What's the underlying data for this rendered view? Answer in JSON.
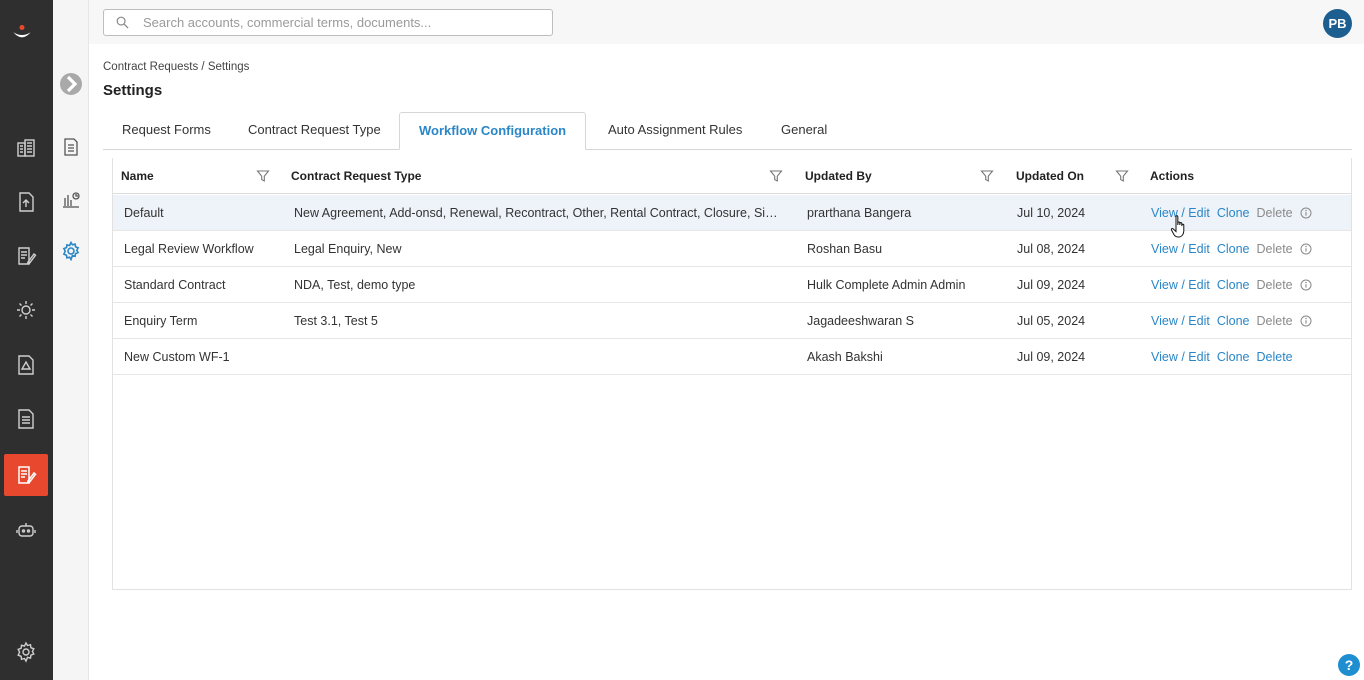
{
  "search": {
    "placeholder": "Search accounts, commercial terms, documents..."
  },
  "user": {
    "initials": "PB"
  },
  "breadcrumb": "Contract Requests / Settings",
  "page_title": "Settings",
  "tabs": [
    {
      "label": "Request Forms"
    },
    {
      "label": "Contract Request Type"
    },
    {
      "label": "Workflow Configuration",
      "active": true
    },
    {
      "label": "Auto Assignment Rules"
    },
    {
      "label": "General"
    }
  ],
  "table": {
    "headers": {
      "name": "Name",
      "type": "Contract Request Type",
      "updated_by": "Updated By",
      "updated_on": "Updated On",
      "actions": "Actions"
    },
    "rows": [
      {
        "name": "Default",
        "type": "New Agreement, Add-onsd, Renewal, Recontract, Other, Rental Contract, Closure, Sign...",
        "updated_by": "prarthana Bangera",
        "updated_on": "Jul 10, 2024",
        "delete_enabled": false,
        "info": true
      },
      {
        "name": "Legal Review Workflow",
        "type": "Legal Enquiry, New",
        "updated_by": "Roshan Basu",
        "updated_on": "Jul 08, 2024",
        "delete_enabled": false,
        "info": true
      },
      {
        "name": "Standard Contract",
        "type": "NDA, Test, demo type",
        "updated_by": "Hulk Complete Admin Admin",
        "updated_on": "Jul 09, 2024",
        "delete_enabled": false,
        "info": true
      },
      {
        "name": "Enquiry Term",
        "type": "Test 3.1, Test 5",
        "updated_by": "Jagadeeshwaran S",
        "updated_on": "Jul 05, 2024",
        "delete_enabled": false,
        "info": true
      },
      {
        "name": "New Custom WF-1",
        "type": "",
        "updated_by": "Akash Bakshi",
        "updated_on": "Jul 09, 2024",
        "delete_enabled": true,
        "info": false
      }
    ],
    "action_labels": {
      "view_edit": "View / Edit",
      "clone": "Clone",
      "delete": "Delete"
    }
  },
  "help": {
    "label": "?"
  },
  "colors": {
    "accent": "#2a86c7",
    "rail": "#2f2f2f",
    "active_rail": "#e8492e",
    "avatar": "#1b5e8f"
  }
}
